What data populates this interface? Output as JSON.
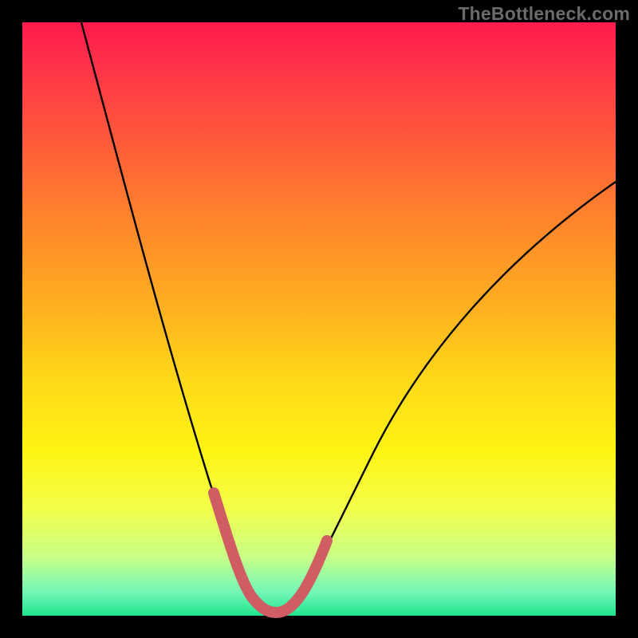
{
  "watermark": {
    "text": "TheBottleneck.com"
  },
  "chart_data": {
    "type": "line",
    "title": "",
    "xlabel": "",
    "ylabel": "",
    "xlim": [
      0,
      100
    ],
    "ylim": [
      0,
      100
    ],
    "series": [
      {
        "name": "curve",
        "x": [
          10,
          15,
          20,
          25,
          30,
          32,
          34,
          36,
          38,
          40,
          42,
          44,
          46,
          48,
          50,
          55,
          60,
          65,
          70,
          75,
          80,
          85,
          90,
          95,
          100
        ],
        "y": [
          100,
          80,
          62,
          44,
          26,
          18,
          12,
          7,
          4,
          3,
          3,
          3,
          4,
          6,
          10,
          20,
          30,
          38,
          46,
          53,
          59,
          64,
          68,
          72,
          75
        ]
      },
      {
        "name": "highlight-band",
        "x": [
          32,
          34,
          36,
          38,
          40,
          42,
          44,
          46,
          48
        ],
        "y": [
          18,
          12,
          7,
          4,
          3,
          3,
          3,
          4,
          6
        ]
      }
    ],
    "colors": {
      "curve": "#000000",
      "highlight": "#cf5d63",
      "gradient_top": "#ff1a4d",
      "gradient_bottom": "#1fe58f"
    }
  }
}
